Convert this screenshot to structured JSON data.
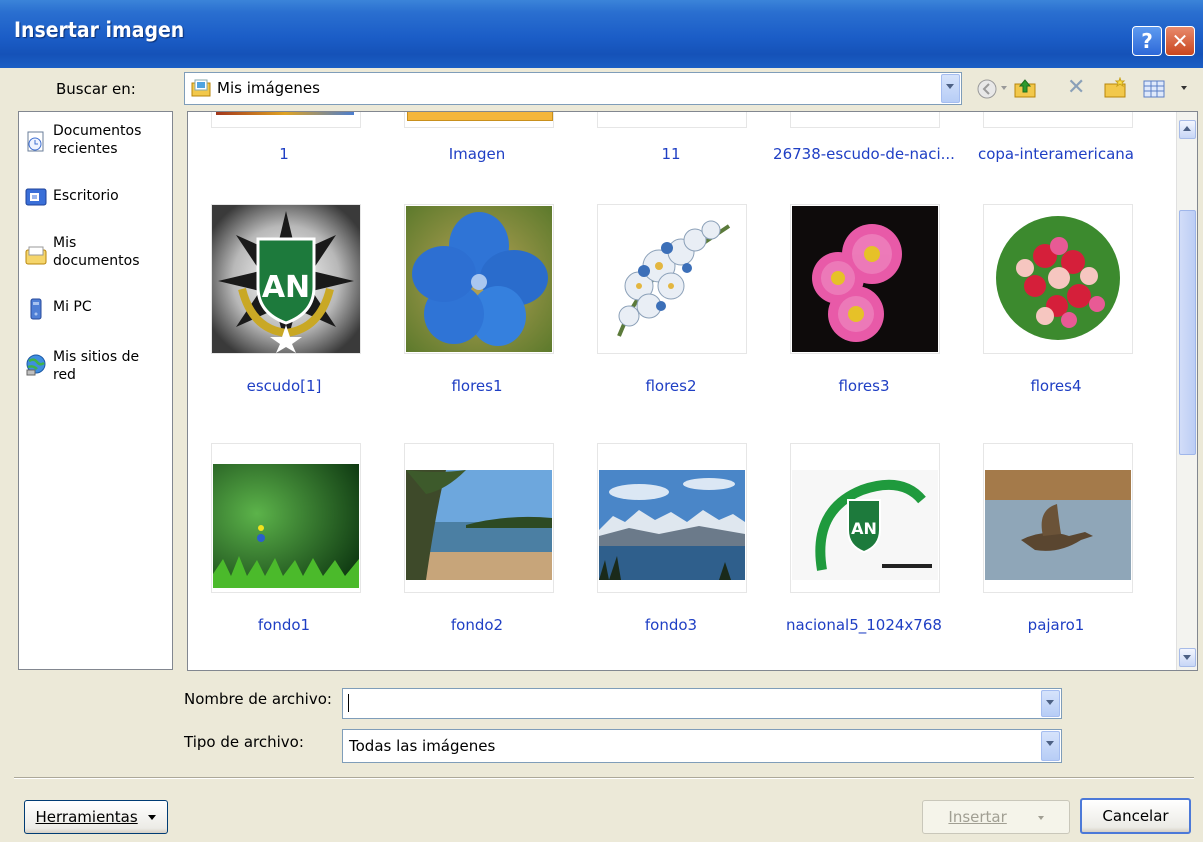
{
  "window": {
    "title": "Insertar imagen",
    "help_label": "?",
    "close_label": "✕"
  },
  "lookin": {
    "label": "Buscar en:",
    "value": "Mis imágenes"
  },
  "places": [
    {
      "label": "Documentos recientes",
      "icon": "recent-documents-icon"
    },
    {
      "label": "Escritorio",
      "icon": "desktop-icon"
    },
    {
      "label": "Mis documentos",
      "icon": "my-documents-icon"
    },
    {
      "label": "Mi PC",
      "icon": "my-computer-icon"
    },
    {
      "label": "Mis sitios de red",
      "icon": "network-places-icon"
    }
  ],
  "files": {
    "row0": [
      "1",
      "Imagen",
      "11",
      "26738-escudo-de-naci...",
      "copa-interamericana"
    ],
    "row1": [
      "escudo[1]",
      "flores1",
      "flores2",
      "flores3",
      "flores4"
    ],
    "row2": [
      "fondo1",
      "fondo2",
      "fondo3",
      "nacional5_1024x768",
      "pajaro1"
    ]
  },
  "filename": {
    "label": "Nombre de archivo:",
    "value": ""
  },
  "filetype": {
    "label": "Tipo de archivo:",
    "value": "Todas las imágenes"
  },
  "buttons": {
    "tools": "Herramientas",
    "insert": "Insertar",
    "cancel": "Cancelar"
  },
  "colors": {
    "title_bar": "#1b5dc7",
    "dialog_bg": "#ece9d8",
    "caption": "#1f3fc4"
  }
}
